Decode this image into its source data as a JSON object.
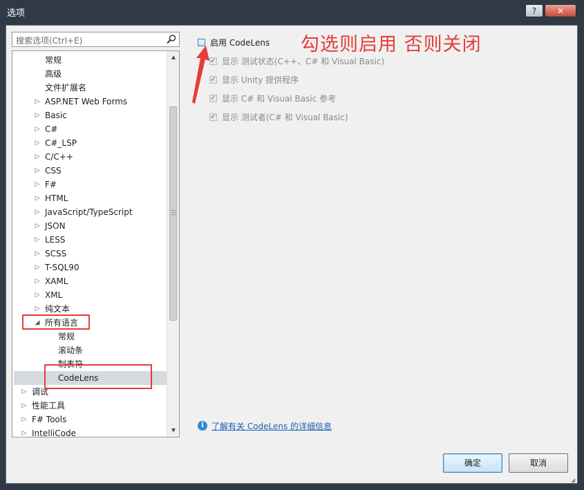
{
  "window": {
    "title": "选项",
    "help_label": "?",
    "close_label": "✕"
  },
  "search": {
    "placeholder": "搜索选项(Ctrl+E)"
  },
  "tree": {
    "items": [
      {
        "label": "常规",
        "indent": 2,
        "arrow": ""
      },
      {
        "label": "高级",
        "indent": 2,
        "arrow": ""
      },
      {
        "label": "文件扩展名",
        "indent": 2,
        "arrow": ""
      },
      {
        "label": "ASP.NET Web Forms",
        "indent": 2,
        "arrow": "▷"
      },
      {
        "label": "Basic",
        "indent": 2,
        "arrow": "▷"
      },
      {
        "label": "C#",
        "indent": 2,
        "arrow": "▷"
      },
      {
        "label": "C#_LSP",
        "indent": 2,
        "arrow": "▷"
      },
      {
        "label": "C/C++",
        "indent": 2,
        "arrow": "▷"
      },
      {
        "label": "CSS",
        "indent": 2,
        "arrow": "▷"
      },
      {
        "label": "F#",
        "indent": 2,
        "arrow": "▷"
      },
      {
        "label": "HTML",
        "indent": 2,
        "arrow": "▷"
      },
      {
        "label": "JavaScript/TypeScript",
        "indent": 2,
        "arrow": "▷"
      },
      {
        "label": "JSON",
        "indent": 2,
        "arrow": "▷"
      },
      {
        "label": "LESS",
        "indent": 2,
        "arrow": "▷"
      },
      {
        "label": "SCSS",
        "indent": 2,
        "arrow": "▷"
      },
      {
        "label": "T-SQL90",
        "indent": 2,
        "arrow": "▷"
      },
      {
        "label": "XAML",
        "indent": 2,
        "arrow": "▷"
      },
      {
        "label": "XML",
        "indent": 2,
        "arrow": "▷"
      },
      {
        "label": "纯文本",
        "indent": 2,
        "arrow": "▷"
      },
      {
        "label": "所有语言",
        "indent": 2,
        "arrow": "◢"
      },
      {
        "label": "常规",
        "indent": 3,
        "arrow": ""
      },
      {
        "label": "滚动条",
        "indent": 3,
        "arrow": ""
      },
      {
        "label": "制表符",
        "indent": 3,
        "arrow": ""
      },
      {
        "label": "CodeLens",
        "indent": 3,
        "arrow": "",
        "selected": true
      },
      {
        "label": "调试",
        "indent": 1,
        "arrow": "▷"
      },
      {
        "label": "性能工具",
        "indent": 1,
        "arrow": "▷"
      },
      {
        "label": "F# Tools",
        "indent": 1,
        "arrow": "▷"
      },
      {
        "label": "IntelliCode",
        "indent": 1,
        "arrow": "▷"
      }
    ]
  },
  "options": {
    "main": {
      "label": "启用 CodeLens",
      "checked": false
    },
    "subs": [
      {
        "label": "显示 测试状态(C++、C# 和 Visual Basic)",
        "checked": true
      },
      {
        "label": "显示 Unity 提供程序",
        "checked": true
      },
      {
        "label": "显示 C# 和 Visual Basic 参考",
        "checked": true
      },
      {
        "label": "显示 测试者(C# 和 Visual Basic)",
        "checked": true
      }
    ]
  },
  "annotation": {
    "text": "勾选则启用  否则关闭",
    "color": "#e63b3b"
  },
  "info": {
    "icon": "i",
    "text": "了解有关 CodeLens 的详细信息"
  },
  "buttons": {
    "ok": "确定",
    "cancel": "取消"
  },
  "colors": {
    "accent": "#e63b3b",
    "link": "#1a5fb4",
    "titlebar": "#2f3a46"
  }
}
